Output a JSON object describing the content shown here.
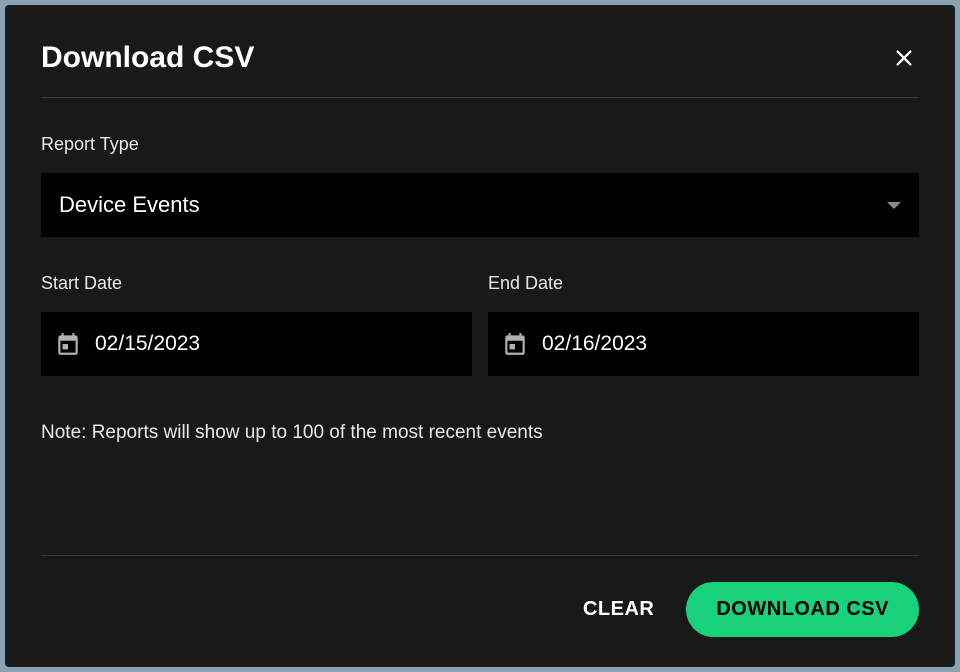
{
  "modal": {
    "title": "Download CSV",
    "report_type": {
      "label": "Report Type",
      "selected": "Device Events"
    },
    "start_date": {
      "label": "Start Date",
      "value": "02/15/2023"
    },
    "end_date": {
      "label": "End Date",
      "value": "02/16/2023"
    },
    "note": "Note: Reports will show up to 100 of the most recent events",
    "actions": {
      "clear": "CLEAR",
      "download": "DOWNLOAD CSV"
    }
  }
}
